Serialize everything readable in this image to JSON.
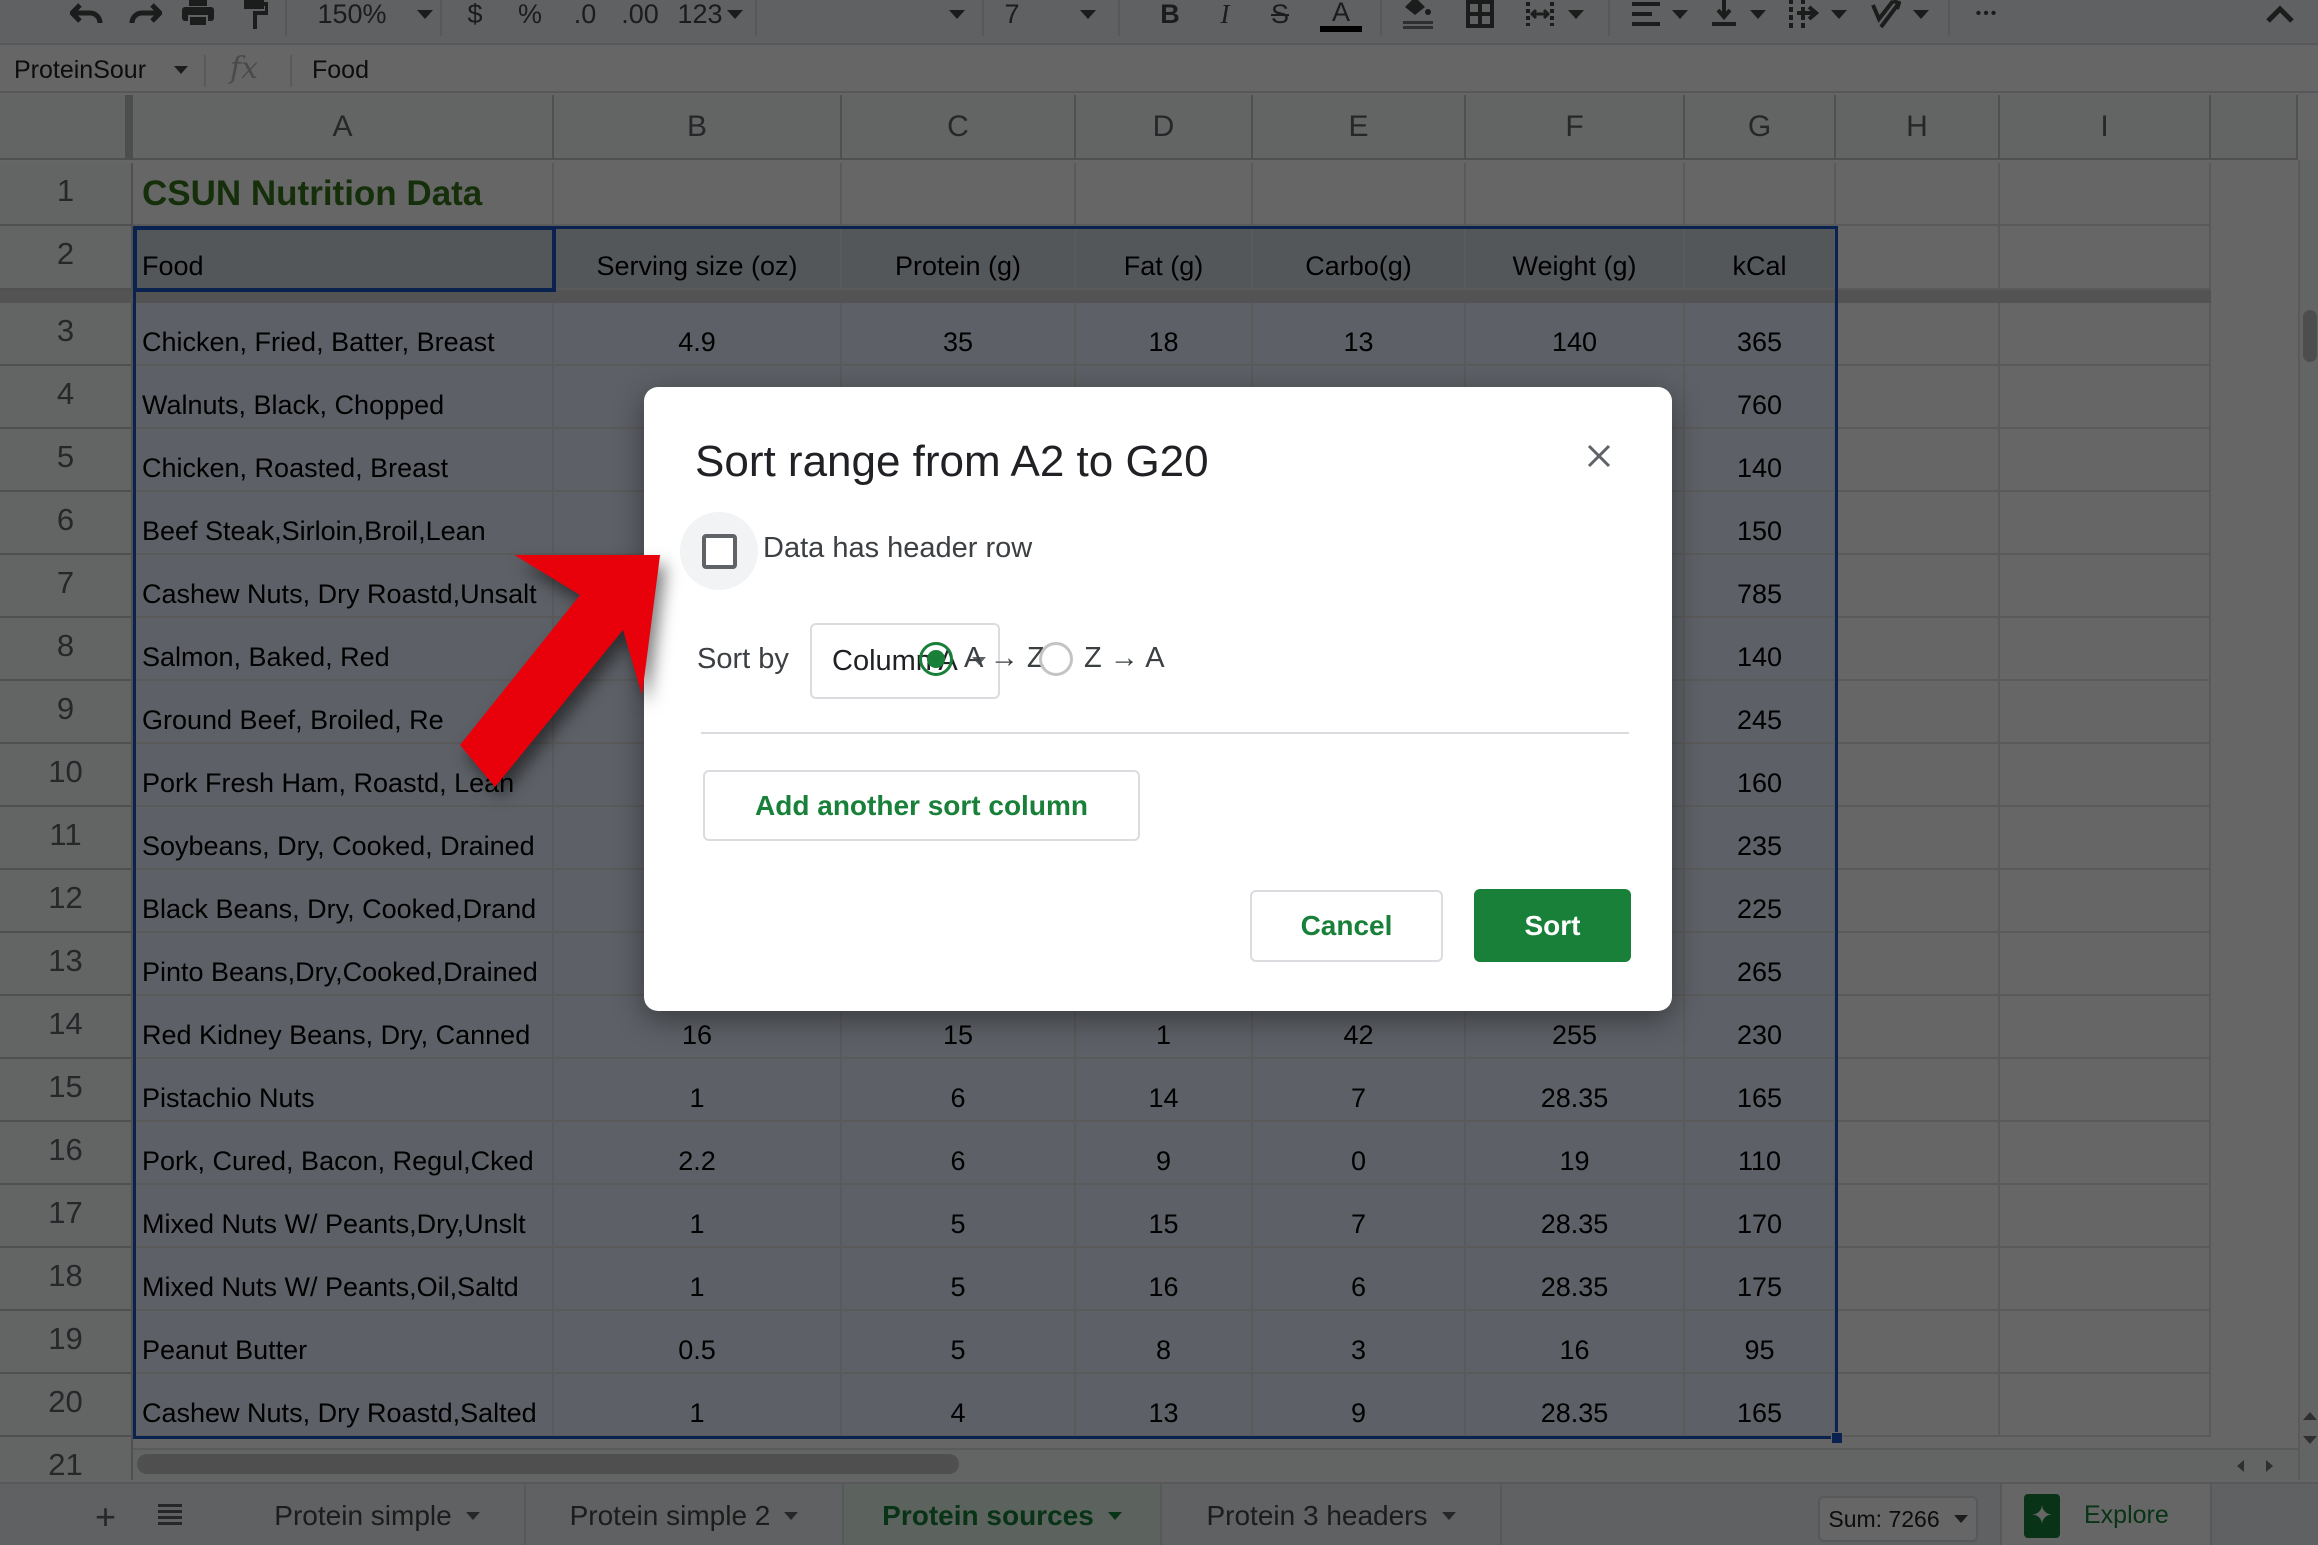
{
  "toolbar": {
    "zoom": "150%",
    "currency_symbol": "$",
    "percent_symbol": "%",
    "decrease_decimal": ".0",
    "increase_decimal": ".00",
    "more_formats": "123",
    "font_size": "7",
    "bold": "B",
    "italic": "I",
    "strikethrough": "S",
    "text_color": "A",
    "more": "•••"
  },
  "formula_bar": {
    "name_box": "ProteinSour",
    "fx": "fx",
    "value": "Food"
  },
  "grid": {
    "columns": [
      "A",
      "B",
      "C",
      "D",
      "E",
      "F",
      "G",
      "H",
      "I"
    ],
    "title_cell": "CSUN Nutrition Data",
    "header_row": [
      "Food",
      "Serving size (oz)",
      "Protein (g)",
      "Fat (g)",
      "Carbo(g)",
      "Weight (g)",
      "kCal"
    ],
    "rows": [
      {
        "num": "3",
        "cells": [
          "Chicken, Fried, Batter, Breast",
          "4.9",
          "35",
          "18",
          "13",
          "140",
          "365"
        ]
      },
      {
        "num": "4",
        "cells": [
          "Walnuts, Black, Chopped",
          "",
          "",
          "",
          "",
          "",
          "760"
        ]
      },
      {
        "num": "5",
        "cells": [
          "Chicken, Roasted, Breast",
          "",
          "",
          "",
          "",
          "",
          "140"
        ]
      },
      {
        "num": "6",
        "cells": [
          "Beef Steak,Sirloin,Broil,Lean",
          "",
          "",
          "",
          "",
          "",
          "150"
        ]
      },
      {
        "num": "7",
        "cells": [
          "Cashew Nuts, Dry Roastd,Unsalt",
          "",
          "",
          "",
          "",
          "",
          "785"
        ]
      },
      {
        "num": "8",
        "cells": [
          "Salmon, Baked, Red",
          "",
          "",
          "",
          "",
          "",
          "140"
        ]
      },
      {
        "num": "9",
        "cells": [
          "Ground Beef, Broiled, Re",
          "",
          "",
          "",
          "",
          "",
          "245"
        ]
      },
      {
        "num": "10",
        "cells": [
          "Pork Fresh Ham, Roastd, Lean",
          "",
          "",
          "",
          "",
          "",
          "160"
        ]
      },
      {
        "num": "11",
        "cells": [
          "Soybeans, Dry, Cooked, Drained",
          "",
          "",
          "",
          "",
          "",
          "235"
        ]
      },
      {
        "num": "12",
        "cells": [
          "Black Beans, Dry, Cooked,Drand",
          "",
          "",
          "",
          "",
          "",
          "225"
        ]
      },
      {
        "num": "13",
        "cells": [
          "Pinto Beans,Dry,Cooked,Drained",
          "",
          "",
          "",
          "",
          "",
          "265"
        ]
      },
      {
        "num": "14",
        "cells": [
          "Red Kidney Beans, Dry, Canned",
          "16",
          "15",
          "1",
          "42",
          "255",
          "230"
        ]
      },
      {
        "num": "15",
        "cells": [
          "Pistachio Nuts",
          "1",
          "6",
          "14",
          "7",
          "28.35",
          "165"
        ]
      },
      {
        "num": "16",
        "cells": [
          "Pork, Cured, Bacon, Regul,Cked",
          "2.2",
          "6",
          "9",
          "0",
          "19",
          "110"
        ]
      },
      {
        "num": "17",
        "cells": [
          "Mixed Nuts W/ Peants,Dry,Unslt",
          "1",
          "5",
          "15",
          "7",
          "28.35",
          "170"
        ]
      },
      {
        "num": "18",
        "cells": [
          "Mixed Nuts W/ Peants,Oil,Saltd",
          "1",
          "5",
          "16",
          "6",
          "28.35",
          "175"
        ]
      },
      {
        "num": "19",
        "cells": [
          "Peanut Butter",
          "0.5",
          "5",
          "8",
          "3",
          "16",
          "95"
        ]
      },
      {
        "num": "20",
        "cells": [
          "Cashew Nuts, Dry Roastd,Salted",
          "1",
          "4",
          "13",
          "9",
          "28.35",
          "165"
        ]
      }
    ]
  },
  "sheet_tabs": {
    "add_label": "+",
    "tabs": [
      {
        "label": "Protein simple",
        "active": false
      },
      {
        "label": "Protein simple 2",
        "active": false
      },
      {
        "label": "Protein sources",
        "active": true
      },
      {
        "label": "Protein 3 headers",
        "active": false
      }
    ],
    "sum": "Sum: 7266",
    "explore": "Explore"
  },
  "dialog": {
    "title": "Sort range from A2 to G20",
    "header_checkbox_label": "Data has header row",
    "header_checkbox_checked": false,
    "sort_by_label": "Sort by",
    "sort_column": "Column A",
    "order_options": [
      {
        "label": "A → Z",
        "selected": true
      },
      {
        "label": "Z → A",
        "selected": false
      }
    ],
    "add_sort_column": "Add another sort column",
    "cancel": "Cancel",
    "sort": "Sort"
  },
  "colors": {
    "accent_green": "#188038",
    "title_green": "#38761d",
    "selection_blue": "#1a56c6",
    "annotation_red": "#e8000b"
  }
}
